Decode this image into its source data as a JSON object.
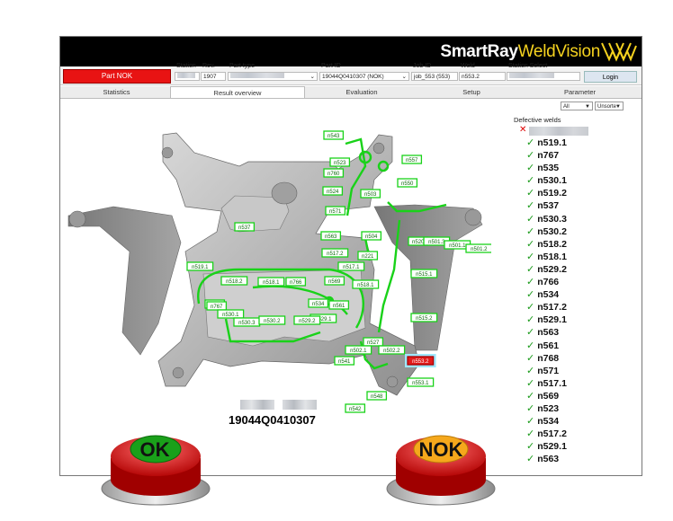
{
  "app": {
    "brand_bold": "SmartRay",
    "brand_light": "WeldVision"
  },
  "status": {
    "label": "Part NOK",
    "color": "#e81313"
  },
  "fields": {
    "station": {
      "label": "Station",
      "value": ""
    },
    "rev": {
      "label": "Rev.",
      "value": "1907"
    },
    "part_type": {
      "label": "Part type",
      "value": ""
    },
    "part_id": {
      "label": "Part ID",
      "value": "19044Q0410307 (NOK)"
    },
    "job_id": {
      "label": "Job ID",
      "value": "job_553 (553)"
    },
    "weld": {
      "label": "Weld",
      "value": "n553.2"
    },
    "station_select": {
      "label": "Station Select",
      "value": ""
    }
  },
  "login_label": "Login",
  "tabs": [
    "Statistics",
    "Result overview",
    "Evaluation",
    "Setup",
    "Parameter"
  ],
  "active_tab": "Result overview",
  "filters": {
    "filter": "All",
    "sort": "Unsorte"
  },
  "defective": {
    "title": "Defective welds",
    "items": [
      "n519.1",
      "n767",
      "n535",
      "n530.1",
      "n519.2",
      "n537",
      "n530.3",
      "n530.2",
      "n518.2",
      "n518.1",
      "n529.2",
      "n766",
      "n534",
      "n517.2",
      "n529.1",
      "n563",
      "n561",
      "n768",
      "n571",
      "n517.1",
      "n569",
      "n523",
      "n534",
      "n517.2",
      "n529.1",
      "n563"
    ]
  },
  "diagram": {
    "labels": [
      "n543",
      "n523",
      "n557",
      "n760",
      "n550",
      "n524",
      "n503",
      "n571",
      "n537",
      "n563",
      "n504",
      "n520",
      "n501.3",
      "n501.1",
      "n501.2",
      "n517.2",
      "n221",
      "n517.1",
      "n519.1",
      "n518.2",
      "n518.1",
      "n766",
      "n569",
      "n518.1",
      "n535",
      "n767",
      "n534",
      "n561",
      "n530.1",
      "n530.3",
      "n530.2",
      "n529.1",
      "n529.2",
      "n515.1",
      "n515.2",
      "n527",
      "n502.2",
      "n502.1",
      "n541",
      "n553.2",
      "n553.1",
      "n548",
      "n542"
    ],
    "nok_label": "n553.2",
    "serial": "19044Q0410307"
  },
  "buttons": {
    "ok": "OK",
    "nok": "NOK"
  },
  "colors": {
    "ok_weld": "#19d219",
    "nok_weld": "#e21c1c",
    "accent": "#f5d21f"
  }
}
